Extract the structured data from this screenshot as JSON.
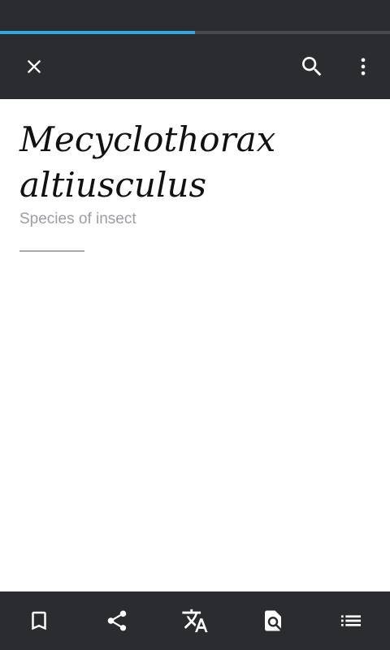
{
  "article": {
    "title": "Mecyclothorax altiusculus",
    "description": "Species of insect"
  },
  "page_load_progress": 0.5,
  "toolbar": {
    "left_icon": "close-icon",
    "right_icons": [
      "search-icon",
      "overflow-menu-icon"
    ]
  },
  "bottom_bar": {
    "icons": [
      "bookmark-icon",
      "share-icon",
      "translate-icon",
      "find-in-page-icon",
      "table-of-contents-icon"
    ]
  },
  "colors": {
    "bar_background": "#2b2c30",
    "progress": "#33a8e0",
    "description_text": "#9a9ea4",
    "icon": "#ffffff"
  }
}
